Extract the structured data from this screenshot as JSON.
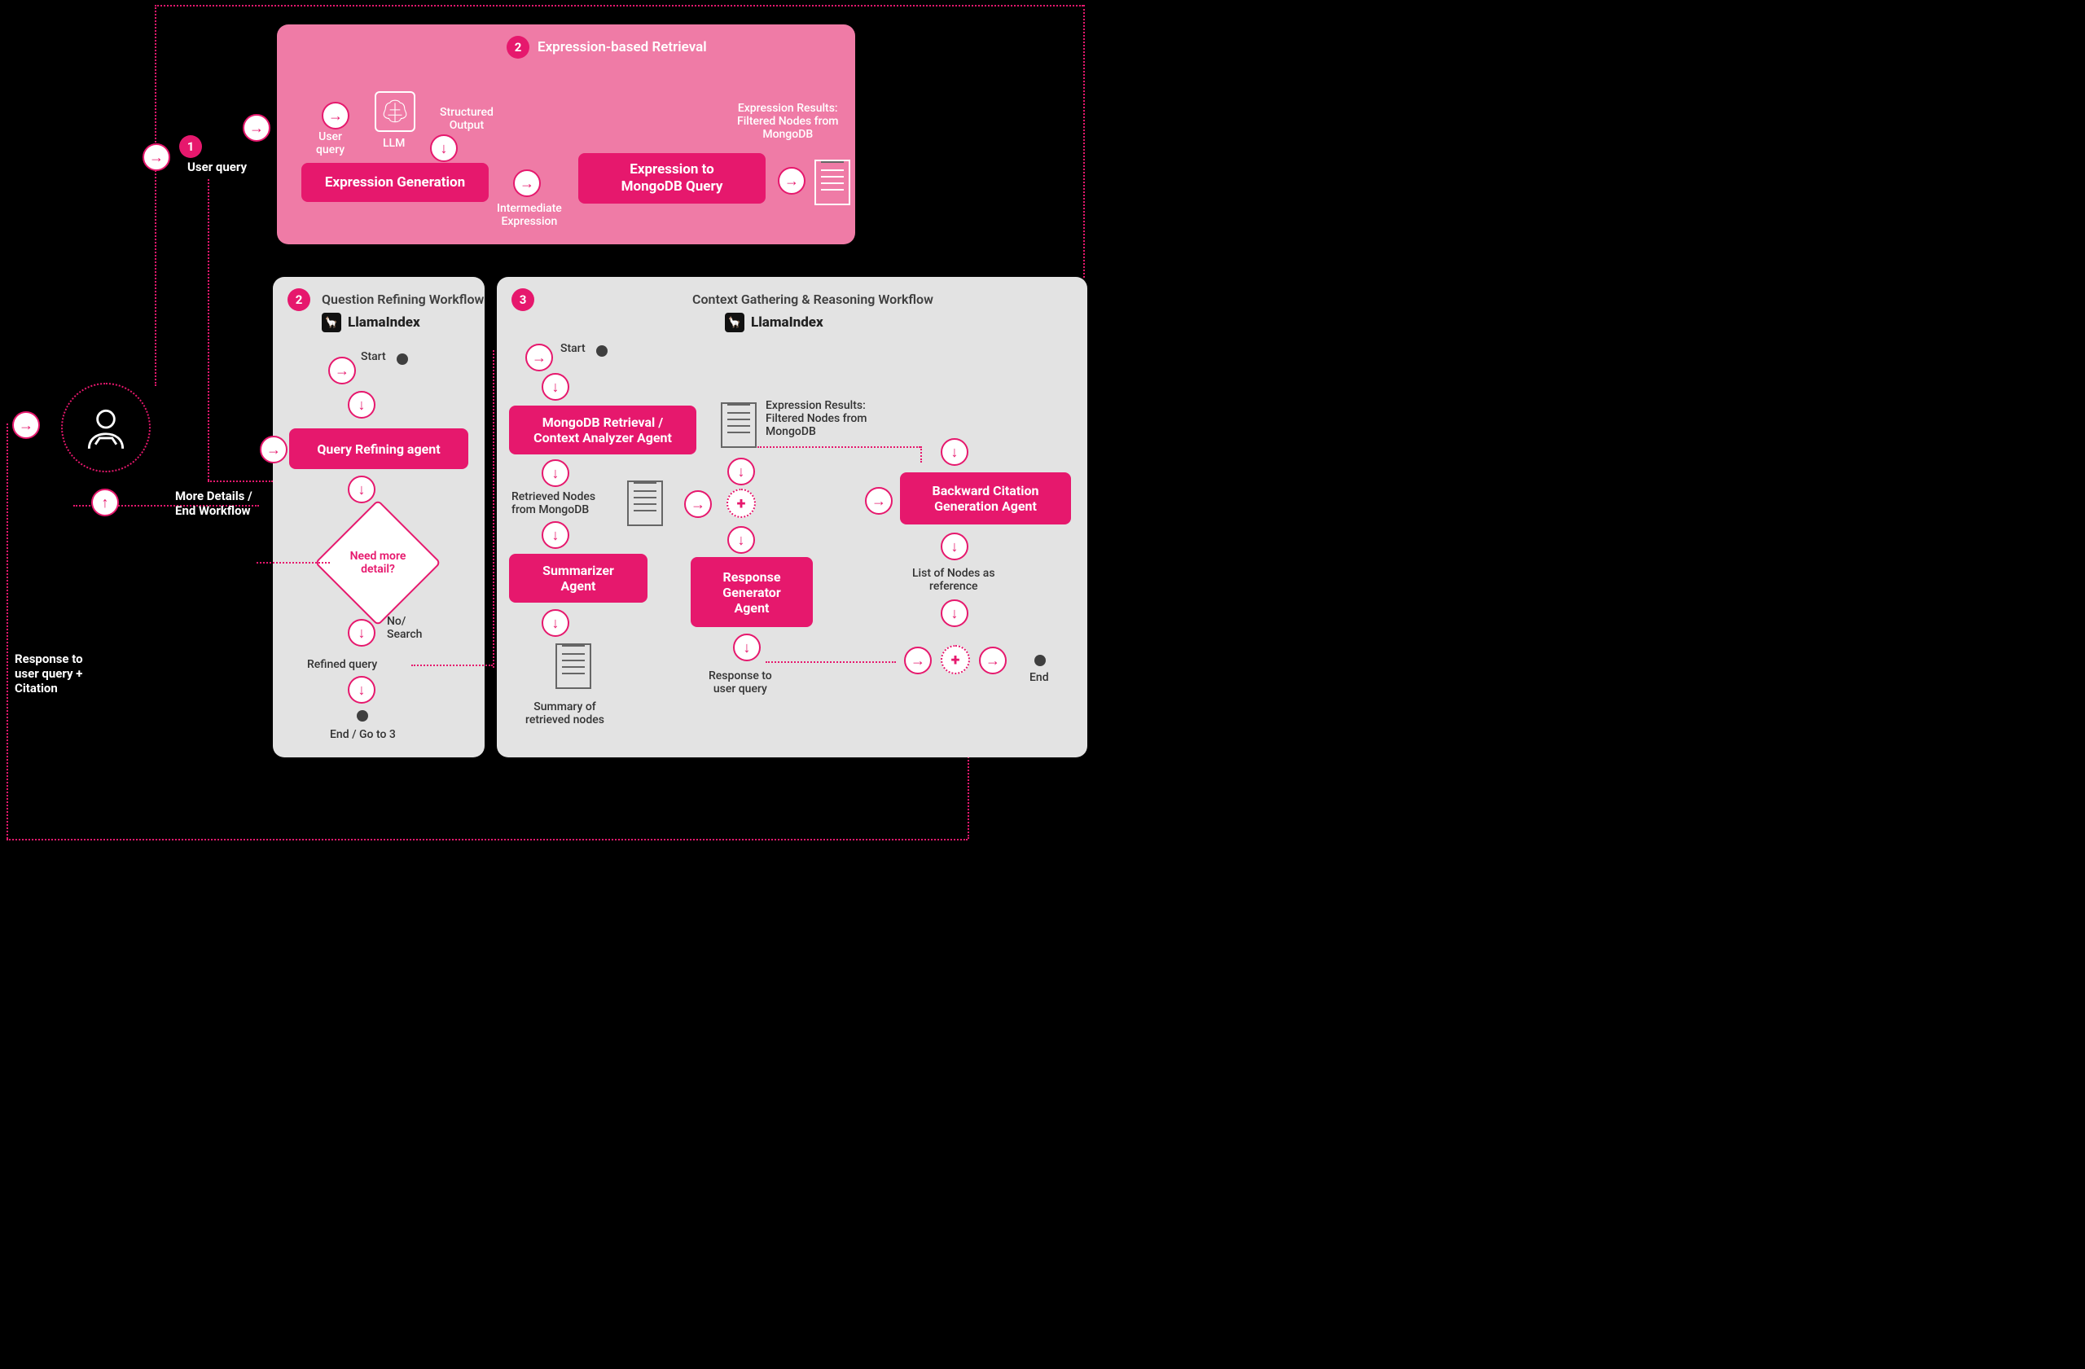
{
  "step1": {
    "num": "1",
    "label": "User query"
  },
  "top_panel": {
    "num": "2",
    "title": "Expression-based Retrieval",
    "user_query": "User\nquery",
    "llm": "LLM",
    "structured_output": "Structured\nOutput",
    "expr_gen": "Expression Generation",
    "intermediate": "Intermediate\nExpression",
    "expr_to_mongo": "Expression to\nMongoDB Query",
    "expr_results": "Expression Results:\nFiltered Nodes from\nMongoDB"
  },
  "panel_q": {
    "num": "2",
    "title": "Question Refining Workflow",
    "brand": "LlamaIndex",
    "start": "Start",
    "agent": "Query Refining agent",
    "decision": "Need more\ndetail?",
    "no_search": "No/\nSearch",
    "refined": "Refined query",
    "end": "End / Go to 3"
  },
  "panel_c": {
    "num": "3",
    "title": "Context Gathering & Reasoning Workflow",
    "brand": "LlamaIndex",
    "start": "Start",
    "retriever": "MongoDB Retrieval /\nContext Analyzer Agent",
    "retrieved_label": "Retrieved Nodes\nfrom MongoDB",
    "summarizer": "Summarizer\nAgent",
    "summary_label": "Summary of\nretrieved nodes",
    "expr_results": "Expression Results:\nFiltered Nodes from\nMongoDB",
    "responder": "Response\nGenerator\nAgent",
    "response_label": "Response to\nuser query",
    "backward": "Backward Citation\nGeneration Agent",
    "list_nodes": "List of Nodes as\nreference",
    "end": "End"
  },
  "ext": {
    "more_details": "More Details /\nEnd Workflow",
    "response_citation": "Response to\nuser query +\nCitation"
  }
}
